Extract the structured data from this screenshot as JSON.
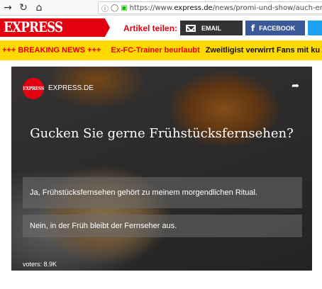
{
  "browser": {
    "url_prefix": "https://www.",
    "url_host": "express.de",
    "url_path": "/news/promi-und-show/auch-entdeckt",
    "icons": [
      "back-icon",
      "reload-icon",
      "home-icon",
      "info-icon",
      "shield-icon",
      "lock-icon"
    ]
  },
  "header": {
    "logo": "EXPRESS",
    "share_label": "Artikel teilen:",
    "email_label": "EMAIL",
    "facebook_label": "FACEBOOK",
    "brand_color": "#e3000f"
  },
  "ticker": {
    "breaking": "+++ BREAKING NEWS +++",
    "item1": "Ex-FC-Trainer beurlaubt",
    "item2": "Zweitligist verwirrt Fans mit ku",
    "background": "#ffd900"
  },
  "poll": {
    "publisher_logo": "EXPRESS",
    "publisher": "EXPRESS.DE",
    "question": "Gucken Sie gerne Frühstücksfernsehen?",
    "answers": [
      "Ja, Frühstücksfernsehen gehört zu meinem morgendlichen Ritual.",
      "Nein, in der Früh bleibt der Fernseher aus."
    ],
    "voters": "voters: 8.9K"
  }
}
